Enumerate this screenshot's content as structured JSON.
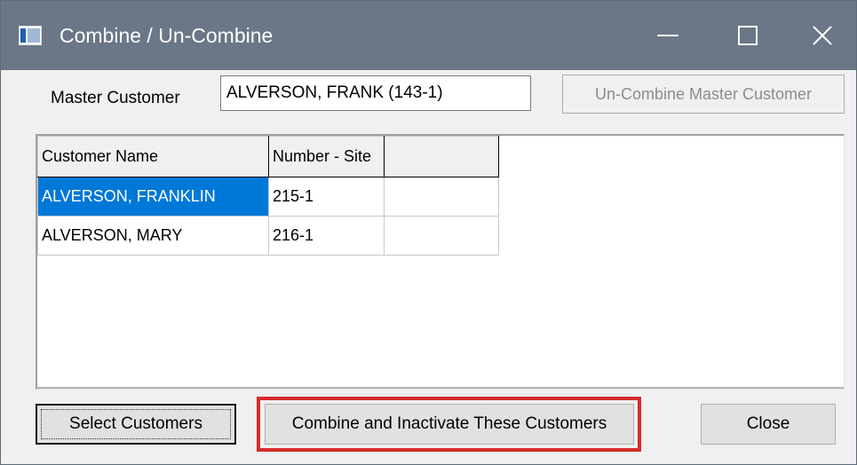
{
  "window": {
    "title": "Combine / Un-Combine",
    "icons": {
      "app": "app-window-icon",
      "minimize": "minimize-icon",
      "maximize": "maximize-icon",
      "close": "close-icon"
    }
  },
  "master": {
    "label": "Master Customer",
    "value": "ALVERSON, FRANK (143-1)",
    "uncombine_button": "Un-Combine Master Customer",
    "uncombine_enabled": false
  },
  "grid": {
    "columns": [
      "Customer Name",
      "Number - Site",
      ""
    ],
    "rows": [
      {
        "name": "ALVERSON, FRANKLIN",
        "number_site": "215-1",
        "extra": "",
        "selected": true
      },
      {
        "name": "ALVERSON, MARY",
        "number_site": "216-1",
        "extra": "",
        "selected": false
      }
    ],
    "selection_color": "#0078d7"
  },
  "buttons": {
    "select": "Select Customers",
    "combine": "Combine and Inactivate These Customers",
    "close": "Close"
  },
  "colors": {
    "titlebar": "#6b7686",
    "highlight_box": "#d62b2b"
  }
}
